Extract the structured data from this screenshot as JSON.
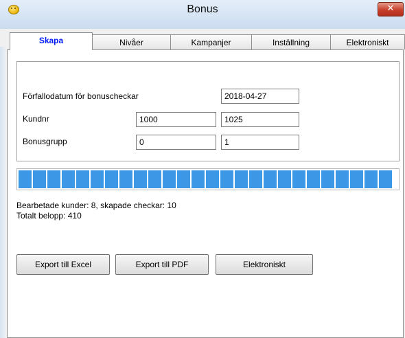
{
  "window": {
    "title": "Bonus",
    "close_glyph": "✕"
  },
  "tabs": [
    {
      "label": "Skapa",
      "active": true
    },
    {
      "label": "Nivåer",
      "active": false
    },
    {
      "label": "Kampanjer",
      "active": false
    },
    {
      "label": "Inställning",
      "active": false
    },
    {
      "label": "Elektroniskt",
      "active": false
    }
  ],
  "form": {
    "expiry_label": "Förfallodatum för bonuscheckar",
    "expiry_value": "2018-04-27",
    "customer_label": "Kundnr",
    "customer_from": "1000",
    "customer_to": "1025",
    "group_label": "Bonusgrupp",
    "group_from": "0",
    "group_to": "1"
  },
  "progress": {
    "fraction": 1.0,
    "color": "#3c97e6"
  },
  "status": {
    "processed": "Bearbetade kunder:  8, skapade checkar:  10",
    "total": "Totalt belopp: 410"
  },
  "buttons": {
    "excel": "Export till Excel",
    "pdf": "Export till PDF",
    "electronic": "Elektroniskt"
  },
  "colors": {
    "active_tab_text": "#0019ff",
    "close_button": "#c7402c"
  },
  "icons": {
    "app": "smiley-icon",
    "close": "close-icon"
  }
}
